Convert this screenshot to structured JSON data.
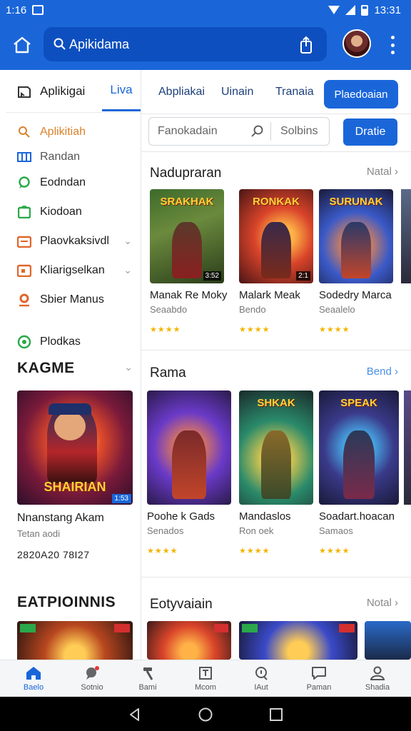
{
  "status_bar": {
    "time": "1:16",
    "right_time": "13:31"
  },
  "app_bar": {
    "search_text": "Apikidama"
  },
  "left_panel": {
    "header_label": "Aplikigai",
    "header_tab": "Liva",
    "nav_items": [
      {
        "label": "Aplikitiah",
        "icon": "search-icon",
        "accent": "#d9822b"
      },
      {
        "label": "Randan",
        "icon": "grid-icon",
        "accent": "#1a66d9"
      },
      {
        "label": "Eodndan",
        "icon": "chat-icon",
        "accent": "#2aa84a"
      },
      {
        "label": "Kiodoan",
        "icon": "game-icon",
        "accent": "#2aa84a"
      },
      {
        "label": "Plaovkaksivdl",
        "icon": "folder-icon",
        "accent": "#e0662a",
        "chevron": "⌄"
      },
      {
        "label": "Kliarigselkan",
        "icon": "calendar-icon",
        "accent": "#e0662a",
        "chevron": "⌄"
      },
      {
        "label": "Sbier Manus",
        "icon": "pin-icon",
        "accent": "#e0662a"
      },
      {
        "label": "Plodkas",
        "icon": "target-icon",
        "accent": "#2aa84a"
      }
    ],
    "section1": {
      "title": "KAGME",
      "chevron": "⌄",
      "card": {
        "logo": "SHAIRIAN",
        "badge": "1:53",
        "title": "Nnanstang Akam",
        "sub": "Tetan aodi",
        "date": "2820A20 78I27"
      }
    },
    "section2": {
      "title": "EATPIOINNIS"
    }
  },
  "right_panel": {
    "tabs": [
      "Abpliakai",
      "Uinain",
      "Tranaia"
    ],
    "active_tab": "Plaedoaian",
    "filter_placeholder": "Fanokadain",
    "filter_sort": "Solbins",
    "filter_button": "Dratie",
    "sections": [
      {
        "title": "Nadupraran",
        "more": "Natal ›",
        "cards": [
          {
            "title": "Manak Re Moky",
            "sub": "Seaabdo",
            "logo": "SRAKHAK",
            "badge": "3:52",
            "stars": "★★★★"
          },
          {
            "title": "Malark Meak",
            "sub": "Bendo",
            "logo": "RONKAK",
            "badge": "2:1",
            "stars": "★★★★"
          },
          {
            "title": "Sodedry Marca",
            "sub": "Seaalelo",
            "logo": "SURUNAK",
            "badge": "",
            "stars": "★★★★"
          }
        ]
      },
      {
        "title": "Rama",
        "more": "Bend ›",
        "cards": [
          {
            "title": "Poohe k Gads",
            "sub": "Senados",
            "logo": "",
            "badge": "",
            "stars": "★★★★"
          },
          {
            "title": "Mandaslos",
            "sub": "Ron oek",
            "logo": "SHKAK",
            "badge": "",
            "stars": "★★★★"
          },
          {
            "title": "Soadart.hoacan",
            "sub": "Samaos",
            "logo": "SPEAK",
            "badge": "",
            "stars": "★★★★"
          }
        ]
      },
      {
        "title": "Eotyvaiain",
        "more": "Notal ›"
      }
    ]
  },
  "bottom_nav": [
    {
      "label": "Baelo",
      "icon": "home-icon",
      "active": true
    },
    {
      "label": "Sotnio",
      "icon": "chat-bubble-icon"
    },
    {
      "label": "Bami",
      "icon": "hammer-icon"
    },
    {
      "label": "Mcom",
      "icon": "box-icon"
    },
    {
      "label": "IAut",
      "icon": "magnifier-chat-icon"
    },
    {
      "label": "Paman",
      "icon": "comment-icon"
    },
    {
      "label": "Shadia",
      "icon": "person-icon"
    }
  ],
  "colors": {
    "brand": "#1a66d9",
    "stars": "#f3b400"
  }
}
